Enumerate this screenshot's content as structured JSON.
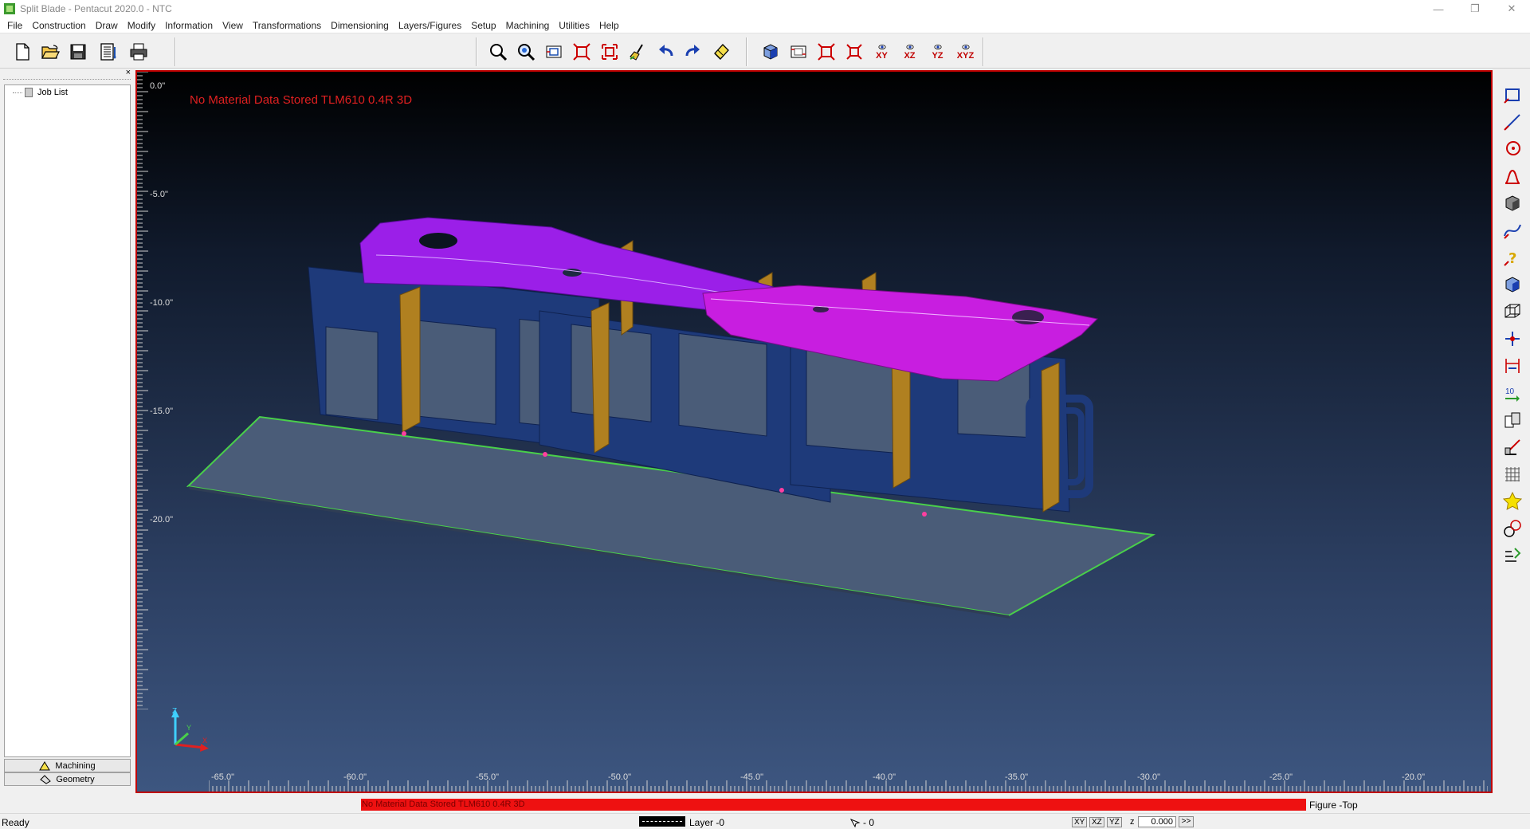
{
  "window": {
    "title": "Split Blade - Pentacut 2020.0 - NTC",
    "minimize": "—",
    "restore": "❐",
    "close": "✕"
  },
  "menu": [
    "File",
    "Construction",
    "Draw",
    "Modify",
    "Information",
    "View",
    "Transformations",
    "Dimensioning",
    "Layers/Figures",
    "Setup",
    "Machining",
    "Utilities",
    "Help"
  ],
  "toolbar": {
    "view_axes": [
      "XY",
      "XZ",
      "YZ",
      "XYZ"
    ]
  },
  "left_panel": {
    "close": "×",
    "tree_root": "Job List",
    "tabs": [
      "Machining",
      "Geometry"
    ]
  },
  "viewport": {
    "banner": "No Material Data Stored TLM610 0.4R 3D",
    "y_ticks": [
      "0.0\"",
      "-5.0\"",
      "-10.0\"",
      "-15.0\"",
      "-20.0\""
    ],
    "x_ticks": [
      "-65.0\"",
      "-60.0\"",
      "-55.0\"",
      "-50.0\"",
      "-45.0\"",
      "-40.0\"",
      "-35.0\"",
      "-30.0\"",
      "-25.0\"",
      "-20.0\""
    ],
    "triad": {
      "x": "X",
      "y": "Y",
      "z": "Z"
    },
    "colors": {
      "frame": "#1e3a7a",
      "upper_blade": "#9b1fe8",
      "lower_blade": "#c81ee0",
      "ribs": "#b08020",
      "base": "#49d04a"
    }
  },
  "status": {
    "message": "No Material Data Stored TLM610 0.4R 3D",
    "figure": "Figure -Top",
    "ready": "Ready",
    "layer": "Layer -0",
    "pick": "- 0",
    "views": [
      "XY",
      "XZ",
      "YZ"
    ],
    "z_label": "z",
    "z_value": "0.000",
    "more": ">>"
  }
}
